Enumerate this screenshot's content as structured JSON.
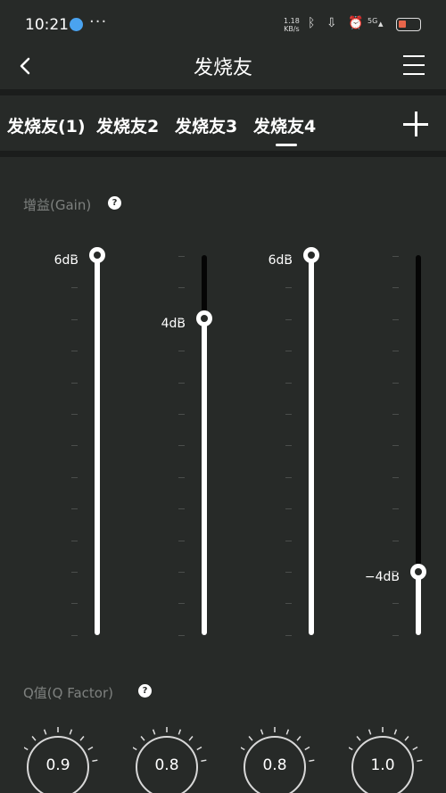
{
  "status_bar": {
    "time": "10:21",
    "dots": "···",
    "speed_value": "1.18",
    "speed_unit": "KB/s",
    "network": "5G"
  },
  "header": {
    "title": "发烧友"
  },
  "tabs": [
    {
      "label": "发烧友(1)",
      "active": false
    },
    {
      "label": "发烧友2",
      "active": false
    },
    {
      "label": "发烧友3",
      "active": false
    },
    {
      "label": "发烧友4",
      "active": true
    }
  ],
  "gain": {
    "label": "增益(Gain)",
    "help": "?",
    "range_db": [
      -6,
      6
    ],
    "bands": [
      {
        "value_label": "6dB",
        "value_db": 6
      },
      {
        "value_label": "4dB",
        "value_db": 4
      },
      {
        "value_label": "6dB",
        "value_db": 6
      },
      {
        "value_label": "−4dB",
        "value_db": -4
      }
    ]
  },
  "q_factor": {
    "label": "Q值(Q  Factor)",
    "help": "?",
    "knobs": [
      {
        "value": "0.9"
      },
      {
        "value": "0.8"
      },
      {
        "value": "0.8"
      },
      {
        "value": "1.0"
      }
    ]
  },
  "icons": {
    "back": "back-arrow-icon",
    "menu": "hamburger-menu-icon",
    "add": "plus-icon",
    "help": "help-circle-icon"
  },
  "colors": {
    "background": "#272a28",
    "accent": "#ffffff",
    "muted_text": "#7e817f"
  }
}
